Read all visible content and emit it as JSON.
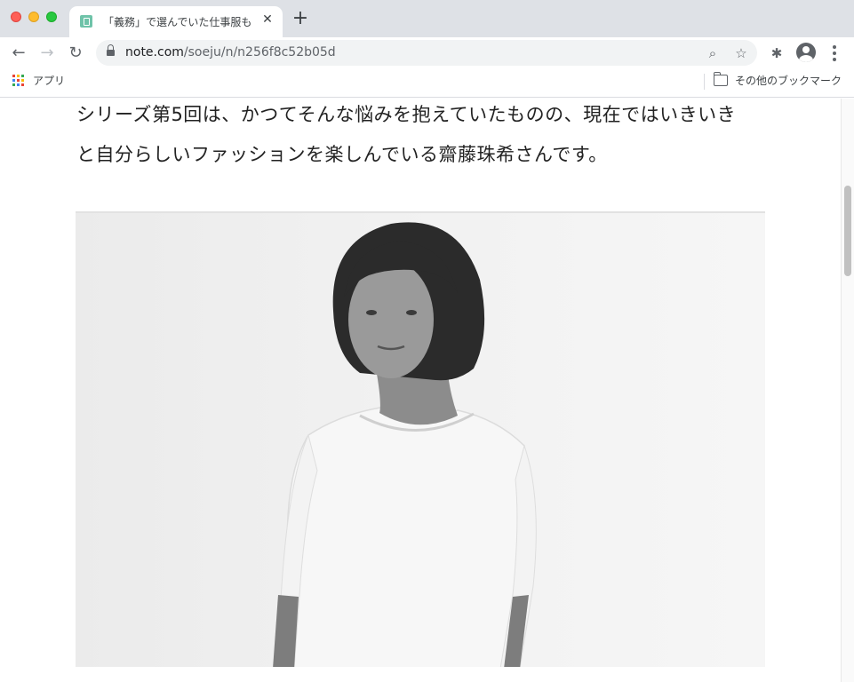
{
  "browser": {
    "tab": {
      "title": "「義務」で選んでいた仕事服も",
      "close_glyph": "✕",
      "favicon": "note-favicon"
    },
    "new_tab_glyph": "+",
    "nav": {
      "back_glyph": "←",
      "forward_glyph": "→",
      "reload_glyph": "↻"
    },
    "omnibox": {
      "url_host": "note.com",
      "url_path": "/soeju/n/n256f8c52b05d",
      "zoom_glyph": "⌕",
      "star_glyph": "☆"
    },
    "extensions_glyph": "✱",
    "bookmarks": {
      "apps_label": "アプリ",
      "other_label": "その他のブックマーク"
    }
  },
  "article": {
    "lines": [
      "シリーズ第5回は、かつてそんな悩みを抱えていたものの、現在ではいきいき",
      "と自分らしいファッションを楽しんでいる齋藤珠希さんです。"
    ]
  },
  "colors": {
    "tabstrip": "#dee1e6",
    "favicon": "#6fc3a9",
    "text": "#222222"
  }
}
